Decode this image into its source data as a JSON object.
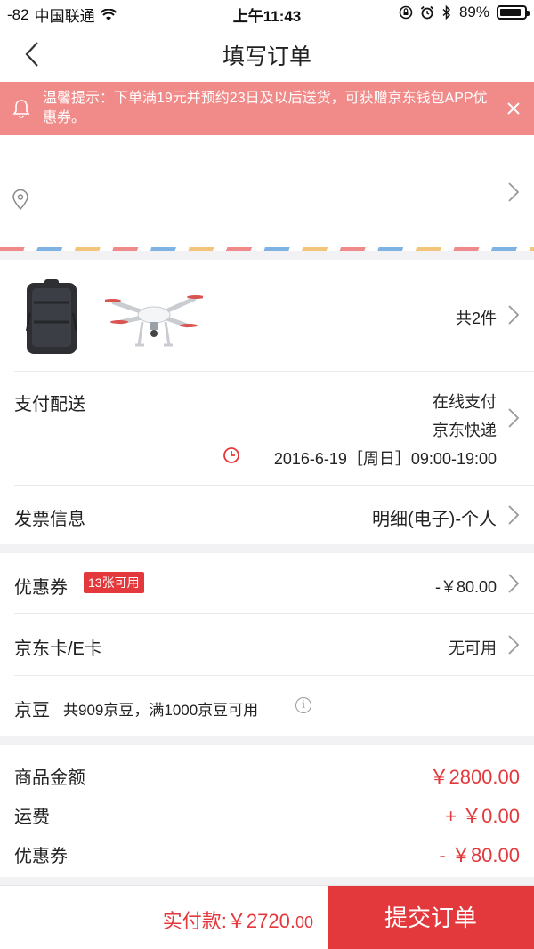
{
  "status_bar": {
    "signal": "-82",
    "carrier": "中国联通",
    "time": "上午11:43",
    "battery_text": "89%",
    "battery_level": 0.89
  },
  "nav": {
    "title": "填写订单"
  },
  "notice": {
    "text": "温馨提示：下单满19元并预约23日及以后送货，可获赠京东钱包APP优惠券。"
  },
  "goods": {
    "count_label": "共2件"
  },
  "payment": {
    "label": "支付配送",
    "method": "在线支付",
    "courier": "京东快递",
    "delivery_time": "2016-6-19［周日］09:00-19:00"
  },
  "invoice": {
    "label": "发票信息",
    "value": "明细(电子)-个人"
  },
  "coupon": {
    "label": "优惠券",
    "badge": "13张可用",
    "value": "-￥80.00"
  },
  "jd_card": {
    "label": "京东卡/E卡",
    "value": "无可用"
  },
  "jingdou": {
    "label": "京豆",
    "desc": "共909京豆，满1000京豆可用"
  },
  "summary": {
    "items": [
      {
        "label": "商品金额",
        "value": "￥2800.00"
      },
      {
        "label": "运费",
        "value": "+ ￥0.00"
      },
      {
        "label": "优惠券",
        "value": "- ￥80.00"
      }
    ]
  },
  "bottom": {
    "pay_label": "实付款:",
    "pay_amount_main": "￥2720.",
    "pay_amount_cents": "00",
    "submit_label": "提交订单"
  },
  "colors": {
    "accent": "#e4393c",
    "notice_bg": "#f08b89"
  }
}
